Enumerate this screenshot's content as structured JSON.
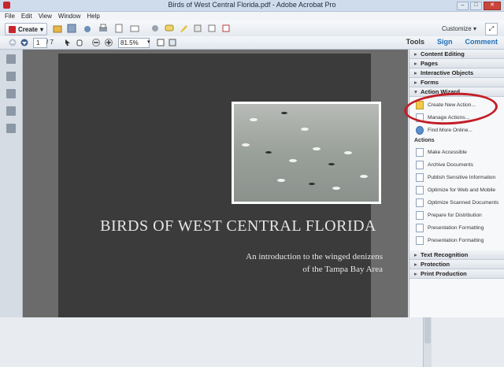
{
  "window": {
    "title": "Birds of West Central Florida.pdf - Adobe Acrobat Pro",
    "buttons": [
      "–",
      "□",
      "✕"
    ]
  },
  "menu": [
    "File",
    "Edit",
    "View",
    "Window",
    "Help"
  ],
  "toolbar": {
    "create_label": "Create",
    "customize_label": "Customize"
  },
  "nav_toolbar": {
    "page_current": "1",
    "page_total": "/ 7",
    "zoom": "81.5%"
  },
  "tabs": {
    "tools": "Tools",
    "sign": "Sign",
    "comment": "Comment"
  },
  "document": {
    "title": "BIRDS OF WEST CENTRAL FLORIDA",
    "subtitle_line1": "An introduction to the winged denizens",
    "subtitle_line2": "of the Tampa Bay Area"
  },
  "right_panel": {
    "sections_top": [
      "Content Editing",
      "Pages",
      "Interactive Objects",
      "Forms"
    ],
    "action_wizard": {
      "label": "Action Wizard",
      "items": [
        "Create New Action...",
        "Manage Actions...",
        "Find More Online..."
      ],
      "actions_label": "Actions",
      "actions": [
        "Make Accessible",
        "Archive Documents",
        "Publish Sensitive Information",
        "Optimize for Web and Mobile",
        "Optimize Scanned Documents",
        "Prepare for Distribution",
        "Presentation Formatting",
        "Presentation Formatting"
      ]
    },
    "sections_bottom": [
      "Text Recognition",
      "Protection",
      "Print Production"
    ]
  },
  "colors": {
    "accent": "#1e6fb7",
    "highlight_ellipse": "#c21e26",
    "slide_bg": "#3b3b3b"
  }
}
